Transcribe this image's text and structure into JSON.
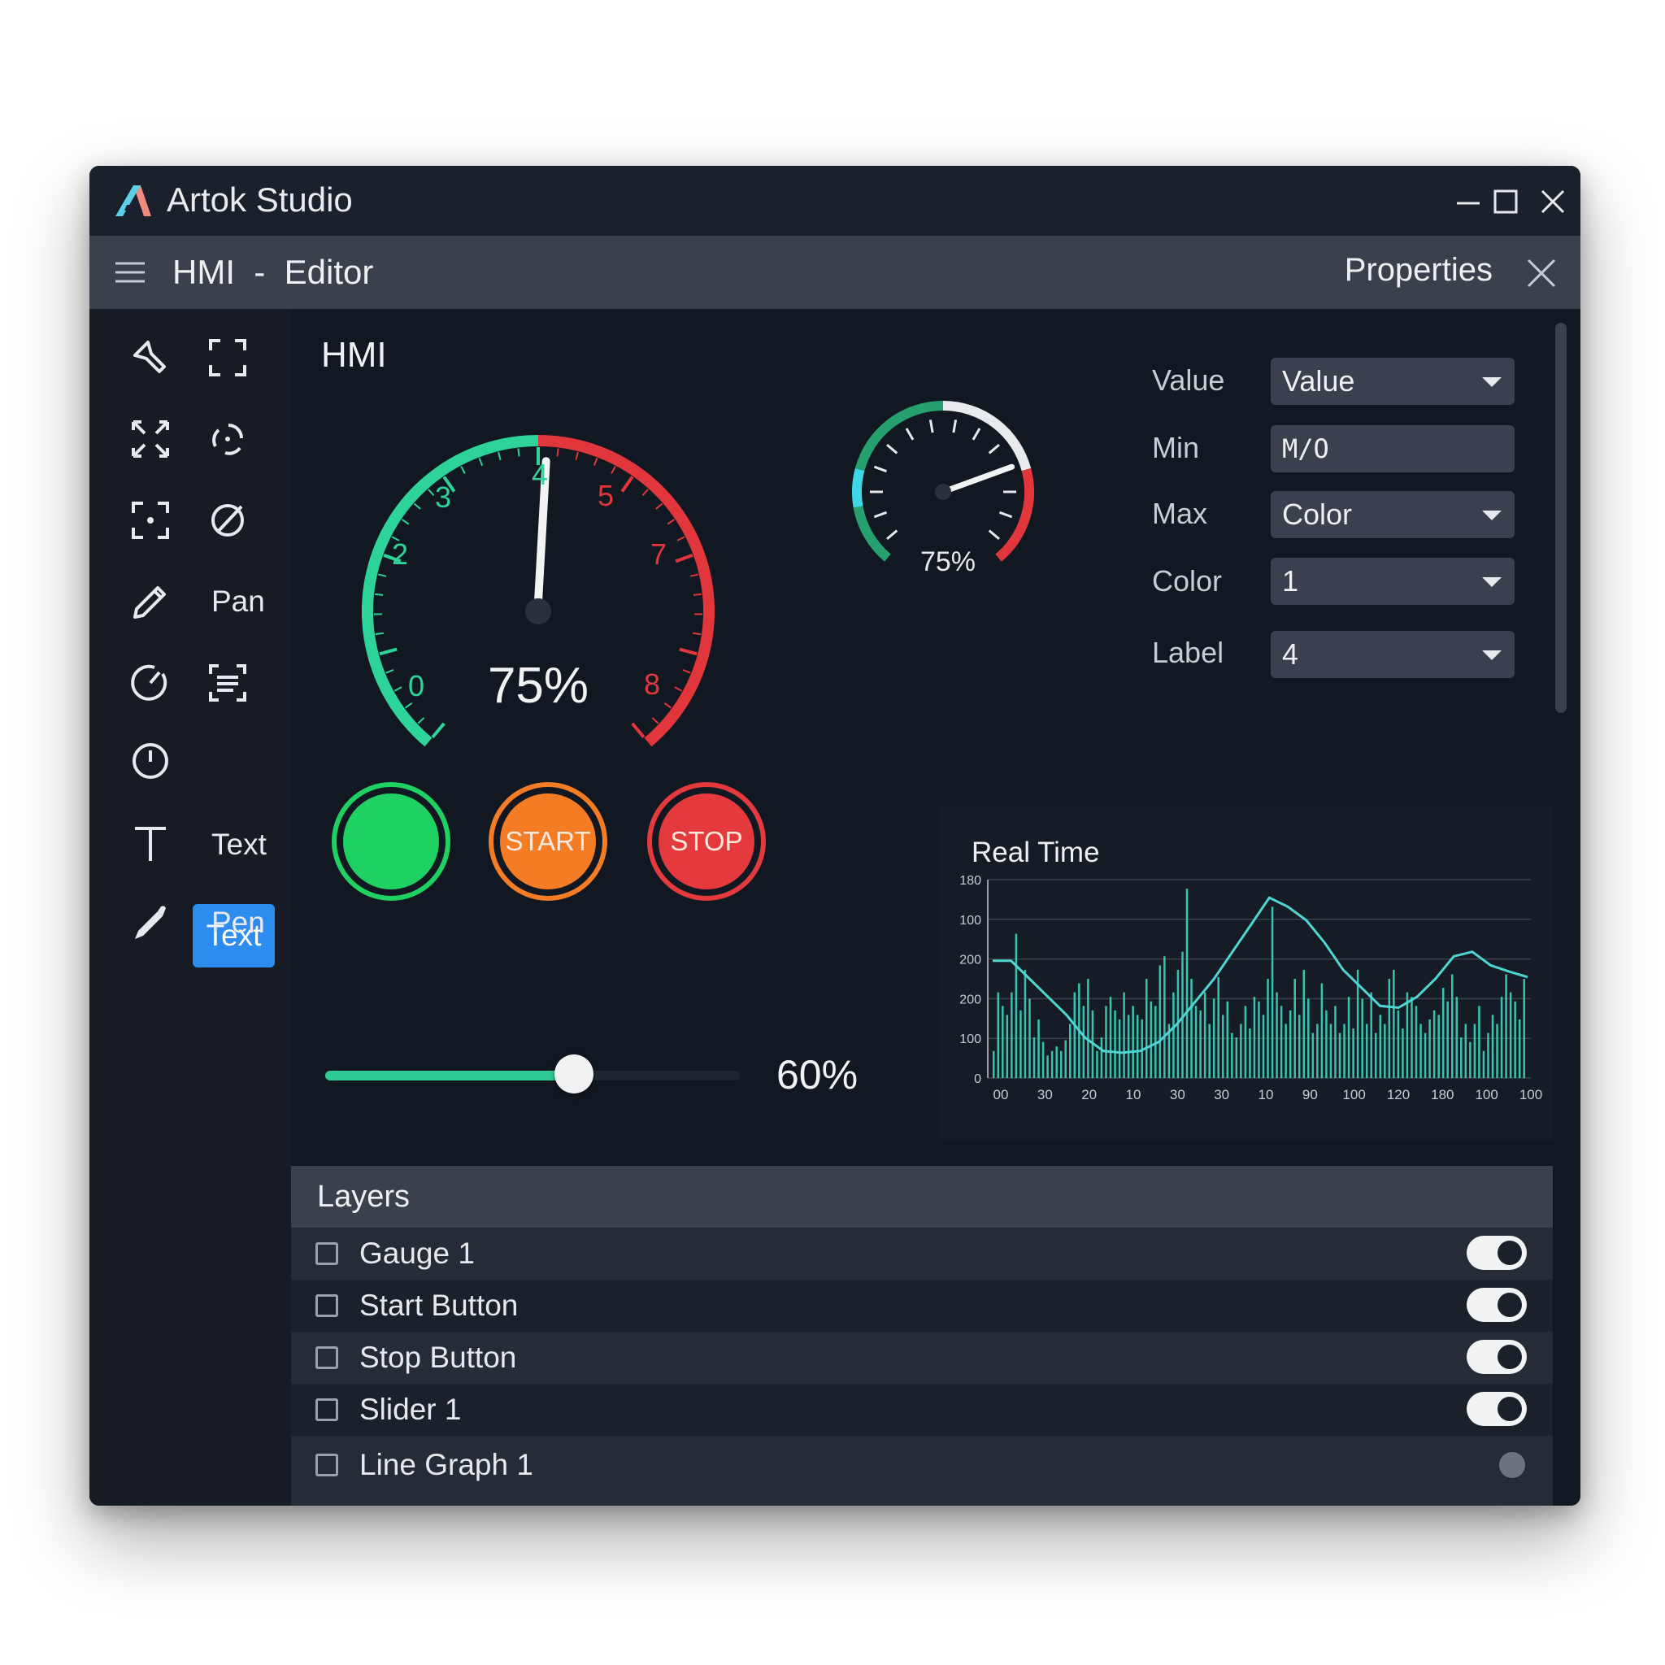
{
  "window": {
    "title": "Artok Studio"
  },
  "subbar": {
    "title": "HMI  -  Editor",
    "properties_title": "Properties"
  },
  "toolbox": {
    "pan": "Pan",
    "text_active": "Text",
    "text": "Text",
    "pen": "Pen"
  },
  "canvas": {
    "label": "HMI"
  },
  "gauge_main": {
    "value_text": "75%",
    "ticks": [
      "0",
      "2",
      "3",
      "4",
      "5",
      "7",
      "8"
    ],
    "colors": {
      "green": "#2ed39a",
      "red": "#e0363c"
    }
  },
  "gauge_small": {
    "value_text": "75%",
    "value": 0.75
  },
  "properties": {
    "fields": [
      {
        "label": "Value",
        "value": "Value",
        "type": "dropdown"
      },
      {
        "label": "Min",
        "value": "M/O",
        "type": "input"
      },
      {
        "label": "Max",
        "value": "Color",
        "type": "dropdown"
      },
      {
        "label": "Color",
        "value": "1",
        "type": "dropdown"
      },
      {
        "label": "Label",
        "value": "4",
        "type": "dropdown"
      }
    ]
  },
  "buttons": {
    "start": "START",
    "stop": "STOP",
    "colors": {
      "green": "#1fd163",
      "orange": "#f47c24",
      "red": "#e43a3d"
    }
  },
  "slider": {
    "value": 0.6,
    "value_text": "60%"
  },
  "chart_data": {
    "type": "bar",
    "title": "Real Time",
    "y_ticks": [
      "0",
      "100",
      "200",
      "200",
      "100",
      "180"
    ],
    "x_ticks": [
      "00",
      "30",
      "20",
      "10",
      "30",
      "30",
      "10",
      "90",
      "100",
      "120",
      "180",
      "100",
      "100"
    ],
    "values": [
      30,
      95,
      80,
      70,
      95,
      160,
      75,
      120,
      88,
      45,
      65,
      40,
      25,
      30,
      35,
      30,
      42,
      60,
      95,
      105,
      80,
      110,
      75,
      30,
      45,
      80,
      90,
      75,
      65,
      95,
      70,
      80,
      70,
      65,
      110,
      85,
      80,
      125,
      135,
      60,
      95,
      120,
      140,
      210,
      110,
      80,
      75,
      95,
      60,
      88,
      112,
      70,
      85,
      50,
      45,
      60,
      80,
      55,
      90,
      85,
      70,
      110,
      190,
      95,
      80,
      60,
      75,
      110,
      70,
      120,
      88,
      50,
      60,
      105,
      75,
      60,
      80,
      50,
      60,
      90,
      55,
      120,
      88,
      60,
      95,
      50,
      70,
      60,
      110,
      120,
      75,
      55,
      95,
      90,
      80,
      60,
      50,
      65,
      75,
      70,
      100,
      85,
      115,
      90,
      45,
      60,
      40,
      60,
      80,
      30,
      50,
      70,
      60,
      90,
      115,
      95,
      85,
      65,
      110
    ],
    "line": [
      130,
      130,
      110,
      90,
      70,
      45,
      30,
      28,
      30,
      40,
      60,
      85,
      110,
      140,
      170,
      200,
      190,
      175,
      150,
      120,
      100,
      80,
      78,
      90,
      110,
      135,
      140,
      125,
      118,
      112
    ],
    "colors": {
      "bars": "#3ee0c8",
      "line": "#4fd6d2"
    }
  },
  "layers": {
    "title": "Layers",
    "items": [
      {
        "name": "Gauge 1",
        "on": true
      },
      {
        "name": "Start Button",
        "on": true
      },
      {
        "name": "Stop Button",
        "on": true
      },
      {
        "name": "Slider 1",
        "on": true
      },
      {
        "name": "Line Graph 1",
        "on": false
      }
    ]
  }
}
